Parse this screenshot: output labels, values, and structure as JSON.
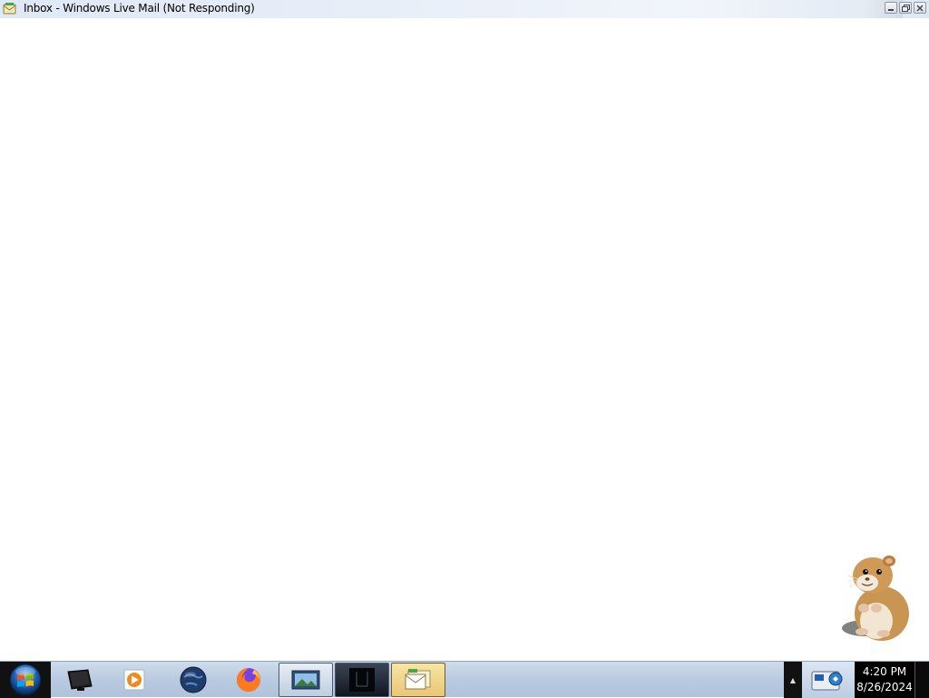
{
  "window": {
    "title": "Inbox - Windows Live Mail (Not Responding)",
    "icon": "windows-live-mail-icon",
    "controls": [
      "minimize-icon",
      "restore-icon",
      "close-icon"
    ]
  },
  "desktop": {
    "mascot": "hamster-icon"
  },
  "taskbar": {
    "start_button": "windows-start-orb-icon",
    "pinned": [
      {
        "name": "display-device-icon"
      },
      {
        "name": "media-player-icon"
      },
      {
        "name": "globe-browser-icon"
      },
      {
        "name": "firefox-icon"
      }
    ],
    "running": [
      {
        "name": "photo-viewer-icon"
      },
      {
        "name": "dark-window-icon"
      },
      {
        "name": "windows-live-mail-icon",
        "active": true
      }
    ],
    "tray": {
      "overflow_arrow": "▲",
      "icons": [
        "network-monitor-icon"
      ]
    },
    "clock": {
      "time": "4:20 PM",
      "date": "8/26/2024"
    }
  },
  "colors": {
    "taskbar": "#b9cbe1",
    "clock_bg": "#000000",
    "active_task": "#e9c774"
  }
}
